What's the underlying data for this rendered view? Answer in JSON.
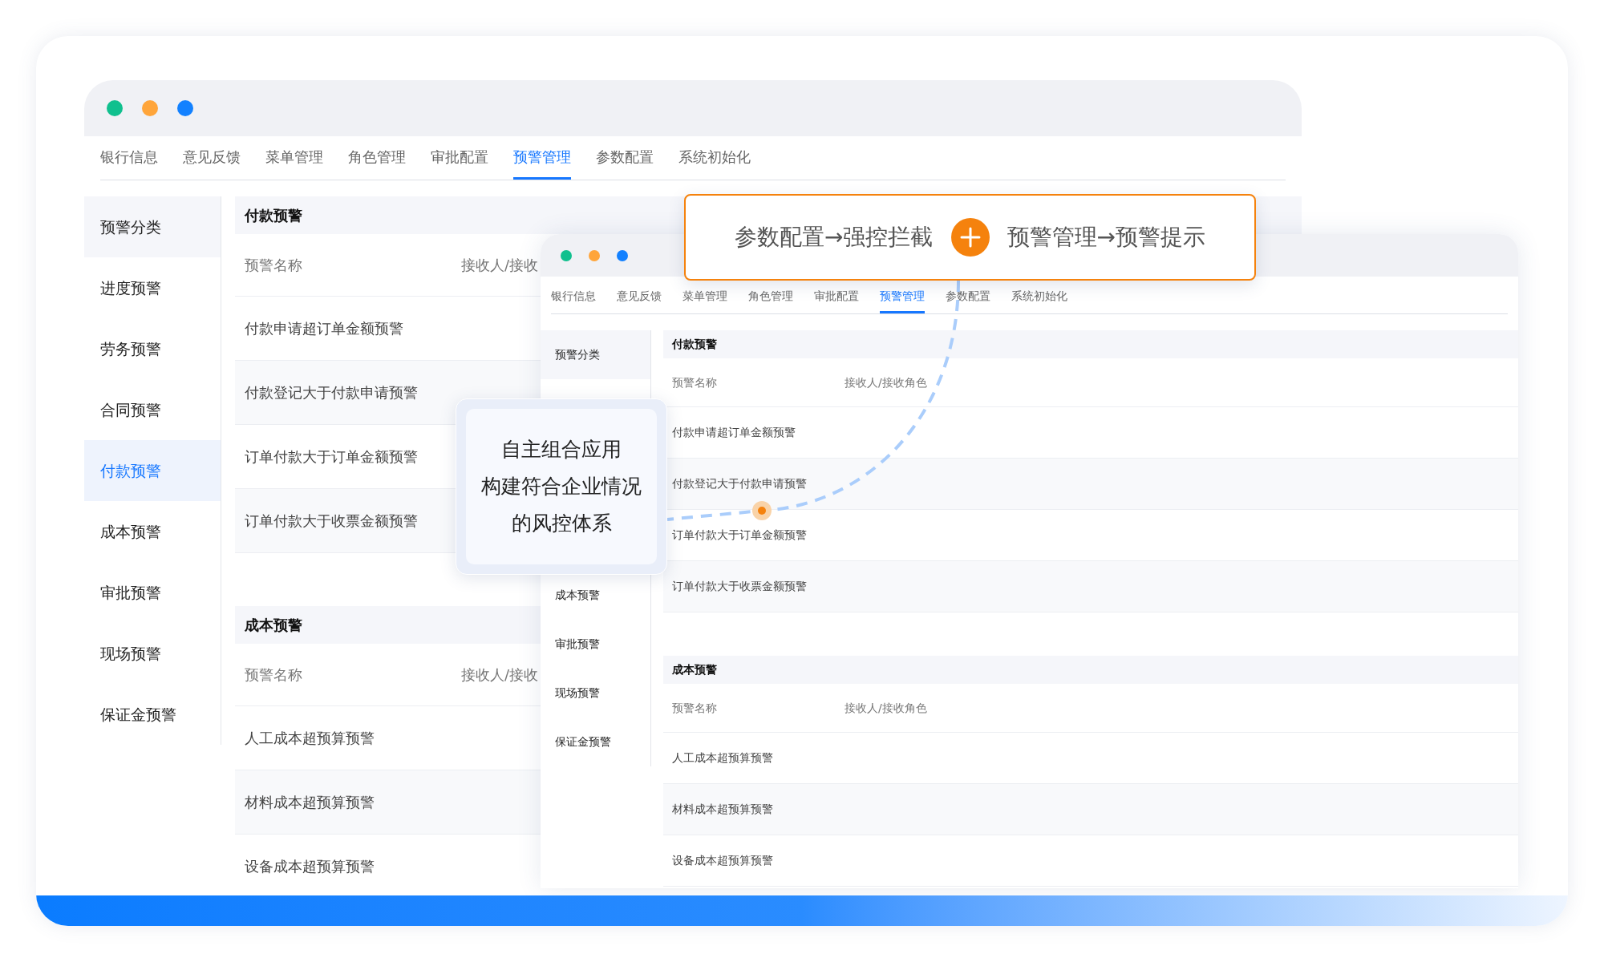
{
  "windows": [
    {
      "tabs": [
        {
          "label": "银行信息",
          "selected": false
        },
        {
          "label": "意见反馈",
          "selected": false
        },
        {
          "label": "菜单管理",
          "selected": false
        },
        {
          "label": "角色管理",
          "selected": false
        },
        {
          "label": "审批配置",
          "selected": false
        },
        {
          "label": "预警管理",
          "selected": true
        },
        {
          "label": "参数配置",
          "selected": false
        },
        {
          "label": "系统初始化",
          "selected": false
        }
      ],
      "sidebar": {
        "heading": "预警分类",
        "items": [
          {
            "label": "进度预警",
            "selected": false
          },
          {
            "label": "劳务预警",
            "selected": false
          },
          {
            "label": "合同预警",
            "selected": false
          },
          {
            "label": "付款预警",
            "selected": true
          },
          {
            "label": "成本预警",
            "selected": false
          },
          {
            "label": "审批预警",
            "selected": false
          },
          {
            "label": "现场预警",
            "selected": false
          },
          {
            "label": "保证金预警",
            "selected": false
          }
        ]
      },
      "sections": [
        {
          "title": "付款预警",
          "columns": [
            "预警名称",
            "接收人/接收"
          ],
          "rows": [
            "付款申请超订单金额预警",
            "付款登记大于付款申请预警",
            "订单付款大于订单金额预警",
            "订单付款大于收票金额预警"
          ]
        },
        {
          "title": "成本预警",
          "columns": [
            "预警名称",
            "接收人/接收"
          ],
          "rows": [
            "人工成本超预算预警",
            "材料成本超预算预警",
            "设备成本超预算预警"
          ]
        }
      ]
    },
    {
      "tabs": [
        {
          "label": "银行信息",
          "selected": false
        },
        {
          "label": "意见反馈",
          "selected": false
        },
        {
          "label": "菜单管理",
          "selected": false
        },
        {
          "label": "角色管理",
          "selected": false
        },
        {
          "label": "审批配置",
          "selected": false
        },
        {
          "label": "预警管理",
          "selected": true
        },
        {
          "label": "参数配置",
          "selected": false
        },
        {
          "label": "系统初始化",
          "selected": false
        }
      ],
      "sidebar": {
        "heading": "预警分类",
        "items": [
          {
            "label": "成本预警",
            "selected": false
          },
          {
            "label": "审批预警",
            "selected": false
          },
          {
            "label": "现场预警",
            "selected": false
          },
          {
            "label": "保证金预警",
            "selected": false
          }
        ]
      },
      "sections": [
        {
          "title": "付款预警",
          "columns": [
            "预警名称",
            "接收人/接收角色"
          ],
          "rows": [
            "付款申请超订单金额预警",
            "付款登记大于付款申请预警",
            "订单付款大于订单金额预警",
            "订单付款大于收票金额预警"
          ]
        },
        {
          "title": "成本预警",
          "columns": [
            "预警名称",
            "接收人/接收角色"
          ],
          "rows": [
            "人工成本超预算预警",
            "材料成本超预算预警",
            "设备成本超预算预警"
          ]
        }
      ]
    }
  ],
  "callout": {
    "left": "参数配置→强控拦截",
    "right": "预警管理→预警提示"
  },
  "tooltip": {
    "lines": [
      "自主组合应用",
      "构建符合企业情况",
      "的风控体系"
    ]
  }
}
